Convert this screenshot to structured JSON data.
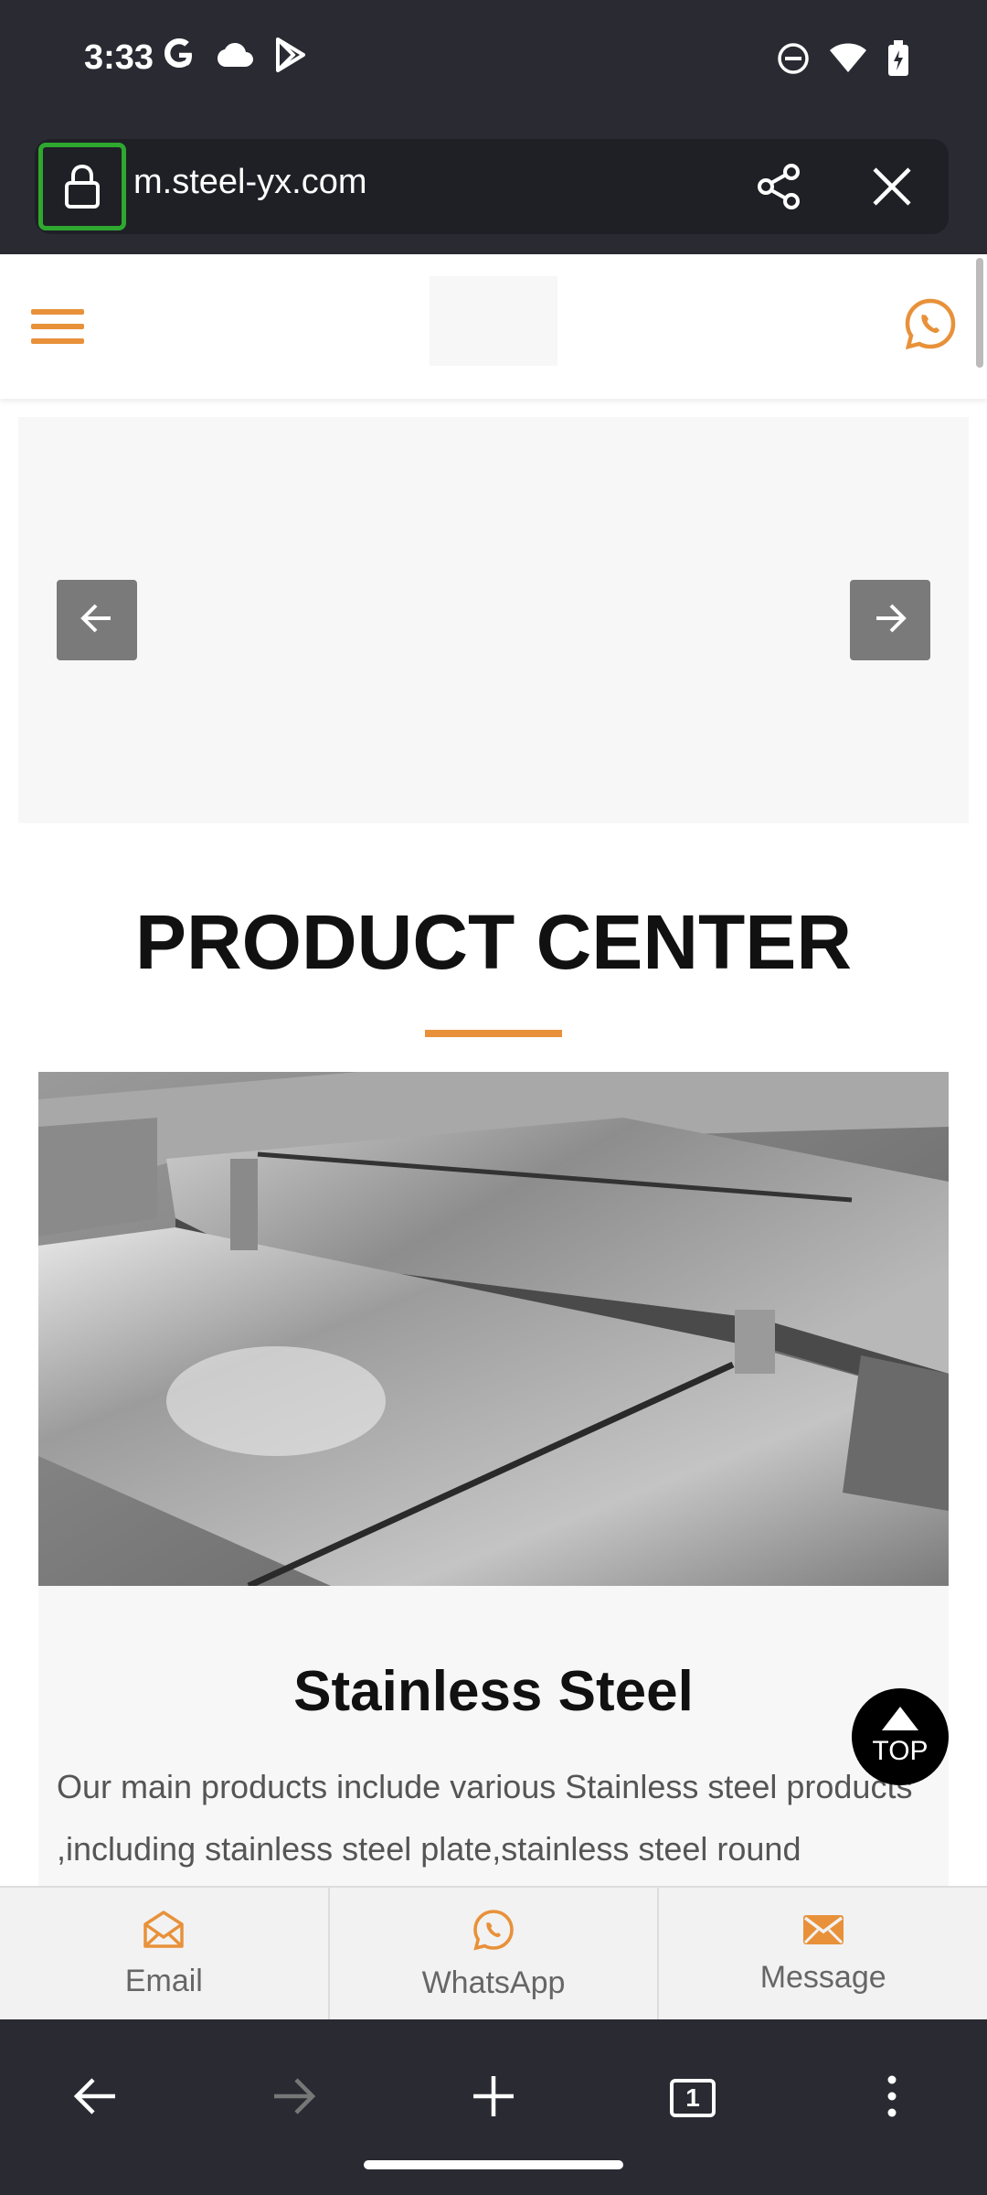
{
  "status_bar": {
    "time": "3:33",
    "icons_left": [
      "google-icon",
      "cloud-icon",
      "play-store-icon"
    ],
    "icons_right": [
      "do-not-disturb-icon",
      "wifi-icon",
      "battery-charging-icon"
    ]
  },
  "browser": {
    "url": "m.steel-yx.com",
    "lock_highlight_color": "#2ea82e"
  },
  "site_header": {
    "accent_color": "#e8913a"
  },
  "banner": {
    "prev_icon": "arrow-left-icon",
    "next_icon": "arrow-right-icon"
  },
  "section": {
    "title": "PRODUCT CENTER"
  },
  "product": {
    "name": "Stainless Steel",
    "description": "Our main products include various Stainless steel products ,including stainless steel plate,stainless steel round"
  },
  "top_button": {
    "label": "TOP"
  },
  "contact_bar": {
    "email_label": "Email",
    "whatsapp_label": "WhatsApp",
    "message_label": "Message"
  },
  "nav_bar": {
    "tab_count": "1"
  }
}
